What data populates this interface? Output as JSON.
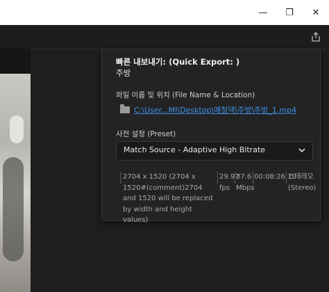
{
  "window": {
    "controls": {
      "minimize_icon": "—",
      "restore_icon": "❐",
      "close_icon": "✕"
    }
  },
  "quick_export": {
    "title": "빠른 내보내기: (Quick Export: )",
    "sequence_name": "주방",
    "file_section_label": "파일 이름 및 위치 (File Name & Location)",
    "file_path": "C:\\User...MI\\Desktop\\예청댁\\주방\\주방_1.mp4",
    "preset_section_label": "사전 설정 (Preset)",
    "preset_value": "Match Source - Adaptive High Bitrate",
    "summary": {
      "resolution": "2704 x 1520 (2704 x 1520#(comment)2704 and 1520 will be replaced by width and height values)",
      "fps": "29.97 fps",
      "bitrate": "37.6 Mbps",
      "duration": "00:08:26:10",
      "audio": "스테레오 (Stereo)",
      "truncated_line": "... ...  ....."
    }
  },
  "colors": {
    "accent_link": "#3f8fe8",
    "panel_bg": "#232323",
    "app_bg": "#1e1e1e"
  }
}
